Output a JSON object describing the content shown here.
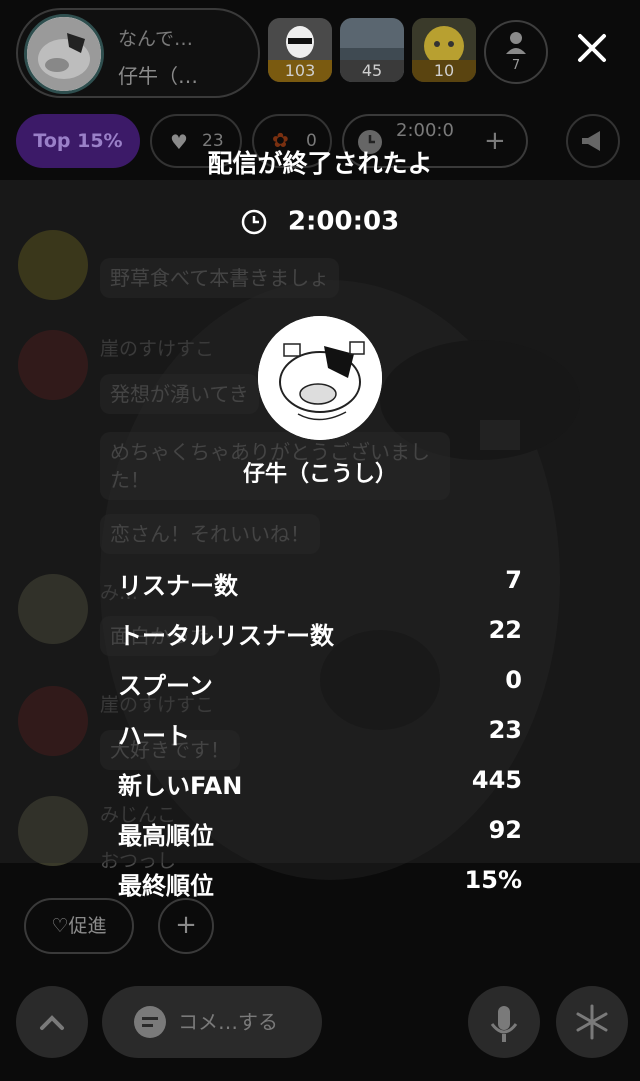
{
  "header": {
    "host_line1": "なんで…",
    "host_line2": "仔牛（…",
    "ranks": [
      {
        "value": "103",
        "color": "#7a5a10"
      },
      {
        "value": "45",
        "color": "#3a3a3a"
      },
      {
        "value": "10",
        "color": "#5a4410"
      }
    ],
    "listener_count": "7"
  },
  "toolbar": {
    "top_badge": "Top 15%",
    "hearts": "23",
    "spoons": "0",
    "timer": "2:00:0"
  },
  "chat": [
    {
      "name": "",
      "message": "野草食べて本書きましょ"
    },
    {
      "name": "崖のすけすこ",
      "message": "発想が湧いてき"
    },
    {
      "name": "",
      "message": "めちゃくちゃありがとうございました！"
    },
    {
      "name": "",
      "message": "恋さん！それいいね！"
    },
    {
      "name": "み…",
      "message": "面白かった"
    },
    {
      "name": "崖のすけすこ",
      "message": "大好きです！"
    },
    {
      "name": "みじんこ",
      "message": "おつっし"
    }
  ],
  "end_screen": {
    "title": "配信が終了されたよ",
    "duration": "2:00:03",
    "dj_name": "仔牛（こうし）",
    "stats": [
      {
        "label": "リスナー数",
        "value": "7"
      },
      {
        "label": "トータルリスナー数",
        "value": "22"
      },
      {
        "label": "スプーン",
        "value": "0"
      },
      {
        "label": "ハート",
        "value": "23"
      },
      {
        "label": "新しいFAN",
        "value": "445"
      },
      {
        "label": "最高順位",
        "value": "92"
      },
      {
        "label": "最終順位",
        "value": "15%"
      }
    ]
  },
  "footer": {
    "promo_label": "♡促進",
    "plus_label": "+",
    "comment_label": "コメ…する"
  },
  "colors": {
    "overlay": "#2a2a2a",
    "top_badge_bg": "#3c1a68"
  }
}
